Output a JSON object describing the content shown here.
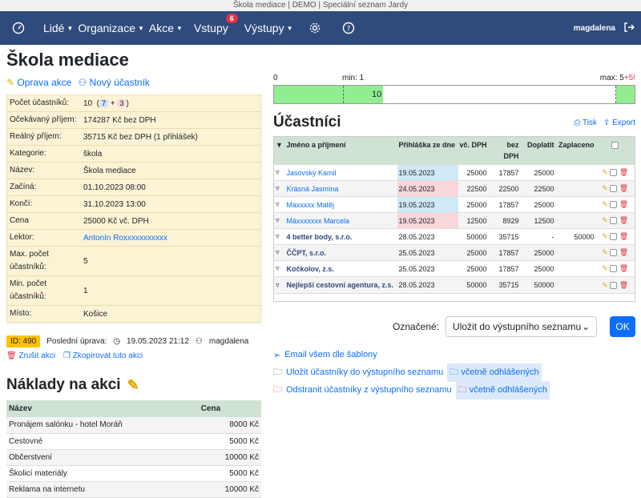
{
  "window_title": "Škola mediace | DEMO | Speciální seznam Jardy",
  "nav": {
    "items": [
      {
        "label": "Lidé"
      },
      {
        "label": "Organizace"
      },
      {
        "label": "Akce"
      },
      {
        "label": "Vstupy",
        "badge": "6"
      },
      {
        "label": "Výstupy"
      }
    ],
    "user": "magdalena"
  },
  "page": {
    "title": "Škola mediace",
    "edit_label": "Oprava akce",
    "new_participant_label": "Nový účastník"
  },
  "info": [
    {
      "k": "Počet účastníků:",
      "v": "10",
      "extra": [
        "7",
        "3"
      ]
    },
    {
      "k": "Očekávaný příjem:",
      "v": "174287 Kč bez DPH"
    },
    {
      "k": "Reálný příjem:",
      "v": "35715 Kč bez DPH (1 přihlášek)"
    },
    {
      "k": "Kategorie:",
      "v": "škola"
    },
    {
      "k": "Název:",
      "v": "Škola mediace"
    },
    {
      "k": "Začíná:",
      "v": "01.10.2023 08:00"
    },
    {
      "k": "Končí:",
      "v": "31.10.2023 13:00"
    },
    {
      "k": "Cena",
      "v": "25000 Kč vč. DPH"
    },
    {
      "k": "Lektor:",
      "v": "Antonín Roxxxxxxxxxxx"
    },
    {
      "k": "Max. počet účastníků:",
      "v": "5"
    },
    {
      "k": "Min. počet účastníků:",
      "v": "1"
    },
    {
      "k": "Místo:",
      "v": "Košice"
    }
  ],
  "meta": {
    "id": "ID: 490",
    "last_edit_label": "Poslední úprava:",
    "last_edit": "19.05.2023 21:12",
    "user": "magdalena",
    "cancel": "Zrušit akci",
    "copy": "Zkopírovat tuto akci"
  },
  "costs": {
    "title": "Náklady na akci",
    "headers": [
      "Název",
      "Cena"
    ],
    "rows": [
      [
        "Pronájem salónku - hotel Moráň",
        "8000 Kč"
      ],
      [
        "Cestovné",
        "5000 Kč"
      ],
      [
        "Občerstvení",
        "10000 Kč"
      ],
      [
        "Školicí materiály",
        "5000 Kč"
      ],
      [
        "Reklama na internetu",
        "10000 Kč"
      ]
    ]
  },
  "capacity": {
    "start": "0",
    "min_label": "min: 1",
    "max_label": "max: 5",
    "over": "+5!",
    "value": "10",
    "value_count": 10,
    "max_count": 5
  },
  "participants": {
    "title": "Účastníci",
    "print": "Tisk",
    "export": "Export",
    "headers": {
      "name": "Jméno a příjmení",
      "application": "Přihláška ze dne",
      "with_vat": "vč. DPH",
      "without_vat": "bez DPH",
      "surcharge": "Doplatit",
      "paid": "Zaplaceno"
    },
    "rows": [
      {
        "name": "Jasovský Kamil",
        "date": "19.05.2023",
        "c": "blue",
        "vat": "25000",
        "novat": "17857",
        "due": "25000",
        "paid": "",
        "bold": false
      },
      {
        "name": "Krásná Jasmína",
        "date": "24.05.2023",
        "c": "pink",
        "vat": "22500",
        "novat": "22500",
        "due": "22500",
        "paid": "",
        "bold": false
      },
      {
        "name": "Maxxxxx Matěj",
        "date": "19.05.2023",
        "c": "blue",
        "vat": "25000",
        "novat": "17857",
        "due": "25000",
        "paid": "",
        "bold": false
      },
      {
        "name": "Máxxxxxxx Marcela",
        "date": "19.05.2023",
        "c": "pink",
        "vat": "12500",
        "novat": "8929",
        "due": "12500",
        "paid": "",
        "bold": false
      },
      {
        "name": "4 better body, s.r.o.",
        "date": "28.05.2023",
        "c": "",
        "vat": "50000",
        "novat": "35715",
        "due": "-",
        "paid": "50000",
        "bold": true
      },
      {
        "name": "ČČPT, s.r.o.",
        "date": "25.05.2023",
        "c": "",
        "vat": "25000",
        "novat": "17857",
        "due": "25000",
        "paid": "",
        "bold": true
      },
      {
        "name": "Kočkolov, z.s.",
        "date": "25.05.2023",
        "c": "",
        "vat": "25000",
        "novat": "17857",
        "due": "25000",
        "paid": "",
        "bold": true
      },
      {
        "name": "Nejlepší cestovní agentura, z.s.",
        "date": "28.05.2023",
        "c": "",
        "vat": "50000",
        "novat": "35715",
        "due": "50000",
        "paid": "",
        "bold": true
      }
    ]
  },
  "bulk": {
    "label": "Označené:",
    "selected": "Uložit do výstupního seznamu",
    "ok": "OK"
  },
  "links": {
    "email": "Email všem dle šablony",
    "save": "Uložit účastníky do výstupního seznamu",
    "save_incl": "včetně odhlášených",
    "remove": "Odstranit účastníky z výstupního seznamu",
    "remove_incl": "včetně odhlášených"
  }
}
